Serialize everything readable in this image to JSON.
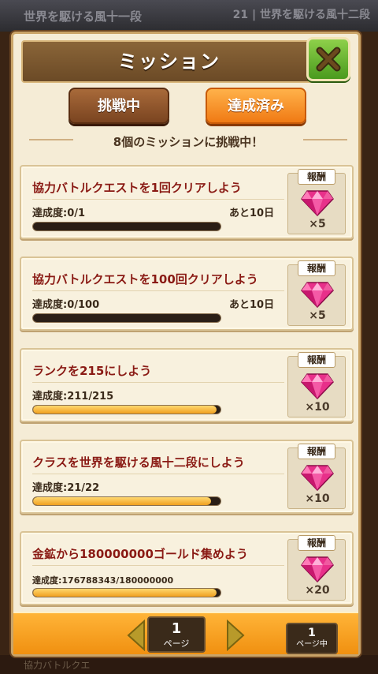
{
  "background": {
    "top_text": "世界を駆ける風十一段",
    "top_right": "21 | 世界を駆ける風十二段",
    "bottom_text": "協力バトルクエ"
  },
  "header": {
    "title": "ミッション",
    "close_icon": "close-x-icon"
  },
  "tabs": [
    {
      "label": "挑戦中",
      "active": true
    },
    {
      "label": "達成済み",
      "active": false
    }
  ],
  "banner": "8個のミッションに挑戦中！",
  "reward_label": "報酬",
  "colors": {
    "accent_orange": "#f07a14",
    "title_red": "#8a1a14",
    "gem_pink": "#e8308a",
    "close_green": "#4a9a1e"
  },
  "missions": [
    {
      "title": "協力バトルクエストを1回クリアしよう",
      "progress_label": "達成度:0/1",
      "remaining": "あと10日",
      "progress": 0.0,
      "reward_icon": "pink-gem-icon",
      "reward_count": "×5"
    },
    {
      "title": "協力バトルクエストを100回クリアしよう",
      "progress_label": "達成度:0/100",
      "remaining": "あと10日",
      "progress": 0.0,
      "reward_icon": "pink-gem-icon",
      "reward_count": "×5"
    },
    {
      "title": "ランクを215にしよう",
      "progress_label": "達成度:211/215",
      "remaining": "",
      "progress": 0.98,
      "reward_icon": "pink-gem-icon",
      "reward_count": "×10"
    },
    {
      "title": "クラスを世界を駆ける風十二段にしよう",
      "progress_label": "達成度:21/22",
      "remaining": "",
      "progress": 0.95,
      "reward_icon": "pink-gem-icon",
      "reward_count": "×10"
    },
    {
      "title": "金鉱から180000000ゴールド集めよう",
      "progress_label": "達成度:176788343/180000000",
      "remaining": "",
      "progress": 0.98,
      "reward_icon": "pink-gem-icon",
      "reward_count": "×20"
    }
  ],
  "pagination": {
    "current": "1",
    "current_unit": "ページ",
    "total": "1",
    "total_unit": "ページ中"
  }
}
